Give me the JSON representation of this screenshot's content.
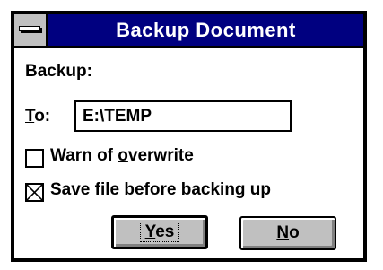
{
  "window": {
    "title": "Backup Document",
    "system_menu_icon": "minus-bar-icon"
  },
  "form": {
    "backup_label": "Backup:",
    "to_label_accel": "T",
    "to_label_rest": "o:",
    "to_value": "E:\\TEMP"
  },
  "options": {
    "warn_label_before": "Warn of ",
    "warn_label_accel": "o",
    "warn_label_after": "verwrite",
    "warn_checked": false,
    "save_label": "Save file before backing up",
    "save_checked": true
  },
  "buttons": {
    "yes_accel": "Y",
    "yes_rest": "es",
    "no_accel": "N",
    "no_rest": "o"
  },
  "colors": {
    "titlebar": "#000080",
    "button_face": "#c0c0c0"
  }
}
